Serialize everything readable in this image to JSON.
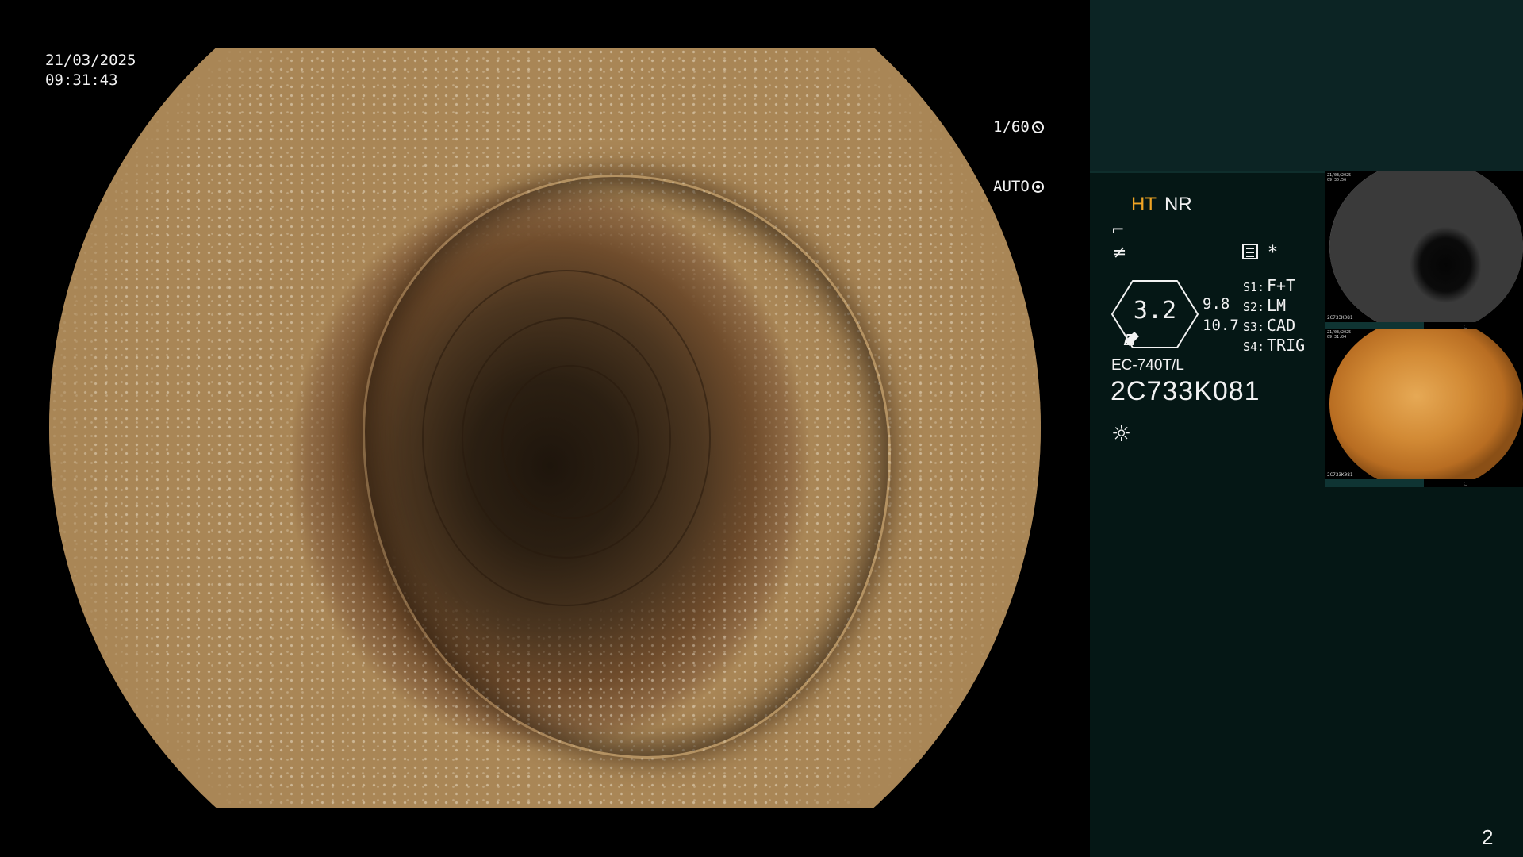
{
  "overlay": {
    "date": "21/03/2025",
    "time": "09:31:43",
    "shutter": "1/60",
    "iris": "AUTO"
  },
  "panel": {
    "mode_ht": "HT",
    "mode_nr": "NR",
    "zoom_value": "3.2",
    "zoom_side_top": "9.8",
    "zoom_side_bottom": "10.7",
    "switches": [
      {
        "key": "S1:",
        "value": "F+T"
      },
      {
        "key": "S2:",
        "value": "LM"
      },
      {
        "key": "S3:",
        "value": "CAD"
      },
      {
        "key": "S4:",
        "value": "TRIG"
      }
    ],
    "scope_model": "EC-740T/L",
    "scope_serial": "2C733K081",
    "star": "*"
  },
  "thumbnails": [
    {
      "timestamp": "21/03/2025\n09:30:56",
      "serial": "2C733K081"
    },
    {
      "timestamp": "21/03/2025\n09:31:04",
      "serial": "2C733K081"
    }
  ],
  "page_number": "2",
  "icons": {
    "shutter": "shutter-icon",
    "iris": "iris-icon",
    "structure_enhance": "structure-enhance-icon",
    "color_enhance": "color-enhance-icon",
    "settings": "settings-icon",
    "light": "light-icon"
  },
  "colors": {
    "panel_bg": "#051715",
    "panel_top": "#0c2424",
    "ht_accent": "#f0a424"
  }
}
